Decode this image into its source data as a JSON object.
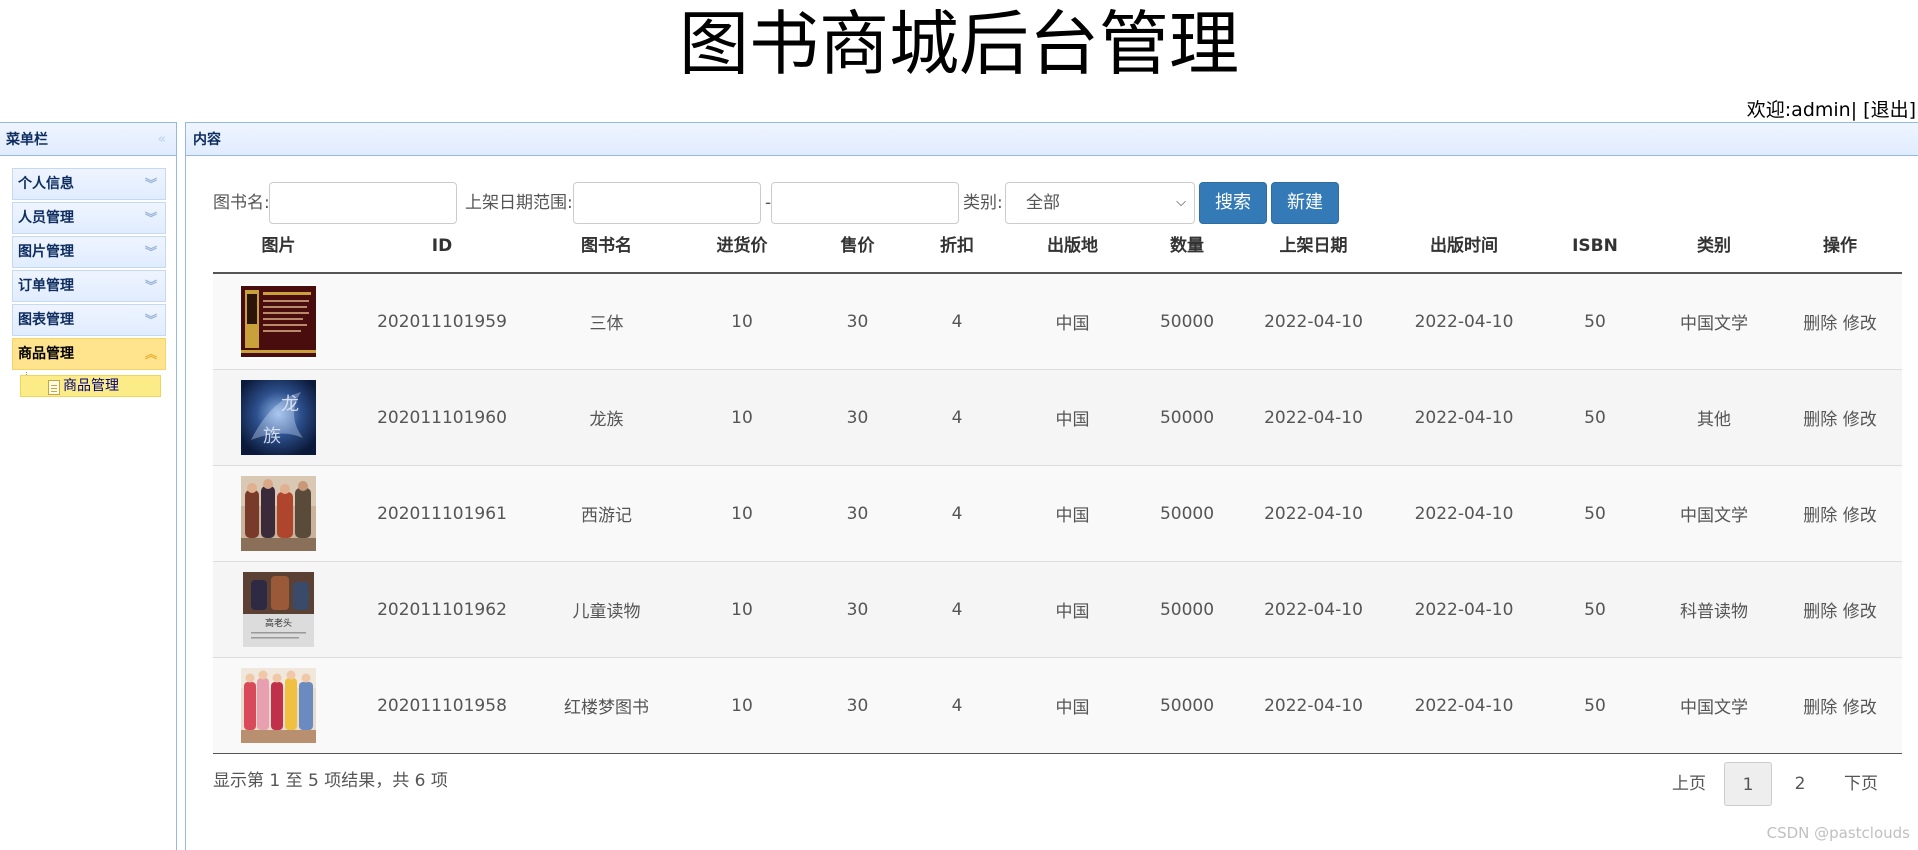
{
  "header": {
    "title": "图书商城后台管理",
    "welcome_label": "欢迎:",
    "username": "admin",
    "separator": "|",
    "logout_label": "[退出]"
  },
  "sidebar": {
    "title": "菜单栏",
    "items": [
      {
        "label": "个人信息"
      },
      {
        "label": "人员管理"
      },
      {
        "label": "图片管理"
      },
      {
        "label": "订单管理"
      },
      {
        "label": "图表管理"
      },
      {
        "label": "商品管理",
        "expanded": true
      }
    ],
    "subitem": "商品管理"
  },
  "content": {
    "title": "内容"
  },
  "search": {
    "name_label": "图书名:",
    "name_value": "",
    "date_label": "上架日期范围:",
    "date_from": "",
    "date_sep": "-",
    "date_to": "",
    "category_label": "类别:",
    "category_value": "全部",
    "search_button": "搜索",
    "new_button": "新建"
  },
  "table": {
    "columns": [
      "图片",
      "ID",
      "图书名",
      "进货价",
      "售价",
      "折扣",
      "出版地",
      "数量",
      "上架日期",
      "出版时间",
      "ISBN",
      "类别",
      "操作"
    ],
    "delete_label": "删除",
    "edit_label": "修改",
    "rows": [
      {
        "image": "book-cover-dark-red",
        "id": "202011101959",
        "name": "三体",
        "cost": "10",
        "price": "30",
        "discount": "4",
        "place": "中国",
        "qty": "50000",
        "shelf_date": "2022-04-10",
        "pub_date": "2022-04-10",
        "isbn": "50",
        "category": "中国文学"
      },
      {
        "image": "book-cover-blue",
        "id": "202011101960",
        "name": "龙族",
        "cost": "10",
        "price": "30",
        "discount": "4",
        "place": "中国",
        "qty": "50000",
        "shelf_date": "2022-04-10",
        "pub_date": "2022-04-10",
        "isbn": "50",
        "category": "其他"
      },
      {
        "image": "book-cover-photo-figures",
        "id": "202011101961",
        "name": "西游记",
        "cost": "10",
        "price": "30",
        "discount": "4",
        "place": "中国",
        "qty": "50000",
        "shelf_date": "2022-04-10",
        "pub_date": "2022-04-10",
        "isbn": "50",
        "category": "中国文学"
      },
      {
        "image": "book-cover-gaolaotou",
        "id": "202011101962",
        "name": "儿童读物",
        "cost": "10",
        "price": "30",
        "discount": "4",
        "place": "中国",
        "qty": "50000",
        "shelf_date": "2022-04-10",
        "pub_date": "2022-04-10",
        "isbn": "50",
        "category": "科普读物"
      },
      {
        "image": "book-cover-photo-costume",
        "id": "202011101958",
        "name": "红楼梦图书",
        "cost": "10",
        "price": "30",
        "discount": "4",
        "place": "中国",
        "qty": "50000",
        "shelf_date": "2022-04-10",
        "pub_date": "2022-04-10",
        "isbn": "50",
        "category": "中国文学"
      }
    ]
  },
  "footer": {
    "info": "显示第 1 至 5 项结果，共 6 项",
    "prev": "上页",
    "pages": [
      "1",
      "2"
    ],
    "next": "下页",
    "current_page": "1"
  },
  "watermark": "CSDN @pastclouds"
}
